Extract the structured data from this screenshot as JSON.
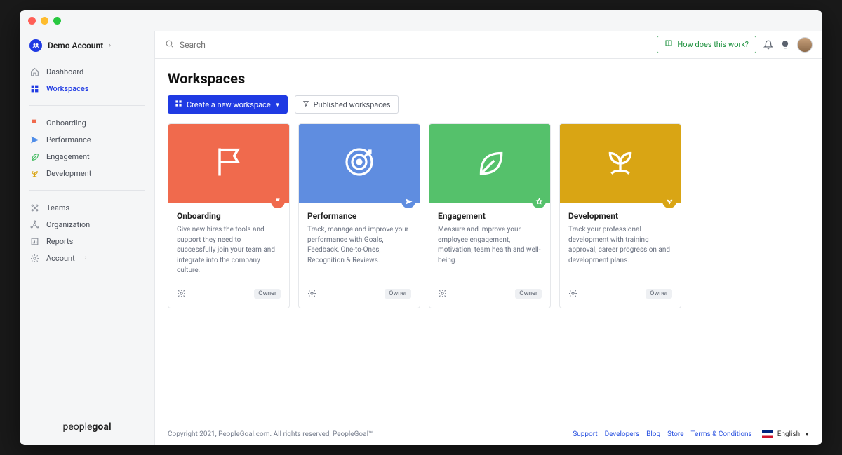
{
  "account": {
    "name": "Demo Account"
  },
  "sidebar": {
    "nav_primary": [
      {
        "label": "Dashboard",
        "icon": "home"
      },
      {
        "label": "Workspaces",
        "icon": "grid",
        "active": true
      }
    ],
    "nav_workspaces": [
      {
        "label": "Onboarding",
        "icon": "flag",
        "color": "#f06a4d"
      },
      {
        "label": "Performance",
        "icon": "send",
        "color": "#4f8de8"
      },
      {
        "label": "Engagement",
        "icon": "leaf",
        "color": "#3fba5d"
      },
      {
        "label": "Development",
        "icon": "sprout",
        "color": "#d9a514"
      }
    ],
    "nav_admin": [
      {
        "label": "Teams",
        "icon": "teams"
      },
      {
        "label": "Organization",
        "icon": "org"
      },
      {
        "label": "Reports",
        "icon": "reports"
      },
      {
        "label": "Account",
        "icon": "settings",
        "chevron": true
      }
    ],
    "brand_prefix": "people",
    "brand_suffix": "goal"
  },
  "topbar": {
    "search_placeholder": "Search",
    "how_label": "How does this work?"
  },
  "page": {
    "title": "Workspaces",
    "create_label": "Create a new workspace",
    "published_label": "Published workspaces"
  },
  "workspaces": [
    {
      "title": "Onboarding",
      "desc": "Give new hires the tools and support they need to successfully join your team and integrate into the company culture.",
      "role": "Owner",
      "color": "#f06a4d",
      "icon": "flag"
    },
    {
      "title": "Performance",
      "desc": "Track, manage and improve your performance with Goals, Feedback, One-to-Ones, Recognition & Reviews.",
      "role": "Owner",
      "color": "#5f8de0",
      "icon": "target"
    },
    {
      "title": "Engagement",
      "desc": "Measure and improve your employee engagement, motivation, team health and well-being.",
      "role": "Owner",
      "color": "#55c16b",
      "icon": "leaf"
    },
    {
      "title": "Development",
      "desc": "Track your professional development with training approval, career progression and development plans.",
      "role": "Owner",
      "color": "#d9a514",
      "icon": "sprout"
    }
  ],
  "footer": {
    "copyright": "Copyright 2021, PeopleGoal.com. All rights reserved, PeopleGoal™",
    "links": [
      "Support",
      "Developers",
      "Blog",
      "Store",
      "Terms & Conditions"
    ],
    "language": "English"
  }
}
